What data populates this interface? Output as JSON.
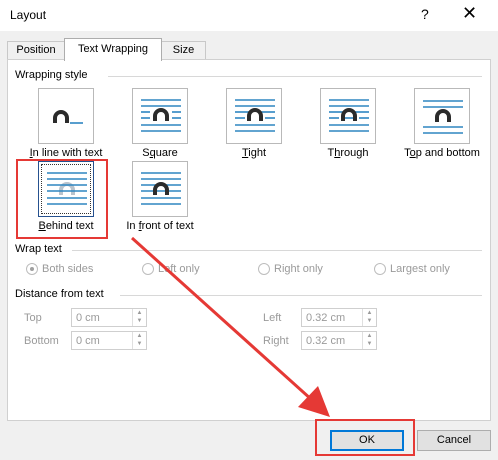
{
  "window": {
    "title": "Layout",
    "help_glyph": "?",
    "close_glyph": "✕"
  },
  "tabs": [
    {
      "label": "Position"
    },
    {
      "label": "Text Wrapping"
    },
    {
      "label": "Size"
    }
  ],
  "wrapping_style": {
    "heading": "Wrapping style",
    "options": [
      {
        "pre": "",
        "u": "I",
        "post": "n line with text"
      },
      {
        "pre": "S",
        "u": "q",
        "post": "uare"
      },
      {
        "pre": "",
        "u": "T",
        "post": "ight"
      },
      {
        "pre": "T",
        "u": "h",
        "post": "rough"
      },
      {
        "pre": "T",
        "u": "o",
        "post": "p and bottom"
      },
      {
        "pre": "",
        "u": "B",
        "post": "ehind text"
      },
      {
        "pre": "In ",
        "u": "f",
        "post": "ront of text"
      }
    ],
    "selected": "Behind text"
  },
  "wrap_text": {
    "heading": "Wrap text",
    "options": [
      {
        "label": "Both sides",
        "checked": true
      },
      {
        "label": "Left only",
        "checked": false
      },
      {
        "label": "Right only",
        "checked": false
      },
      {
        "label": "Largest only",
        "checked": false
      }
    ]
  },
  "distance": {
    "heading": "Distance from text",
    "top": {
      "label": "Top",
      "value": "0 cm"
    },
    "bottom": {
      "label": "Bottom",
      "value": "0 cm"
    },
    "left": {
      "label": "Left",
      "value": "0.32 cm"
    },
    "right": {
      "label": "Right",
      "value": "0.32 cm"
    }
  },
  "buttons": {
    "ok": "OK",
    "cancel": "Cancel"
  },
  "colors": {
    "accent": "#0078d7",
    "annotation": "#e53935",
    "icon_line": "#2e86c1",
    "icon_shape": "#2b2b2b"
  }
}
